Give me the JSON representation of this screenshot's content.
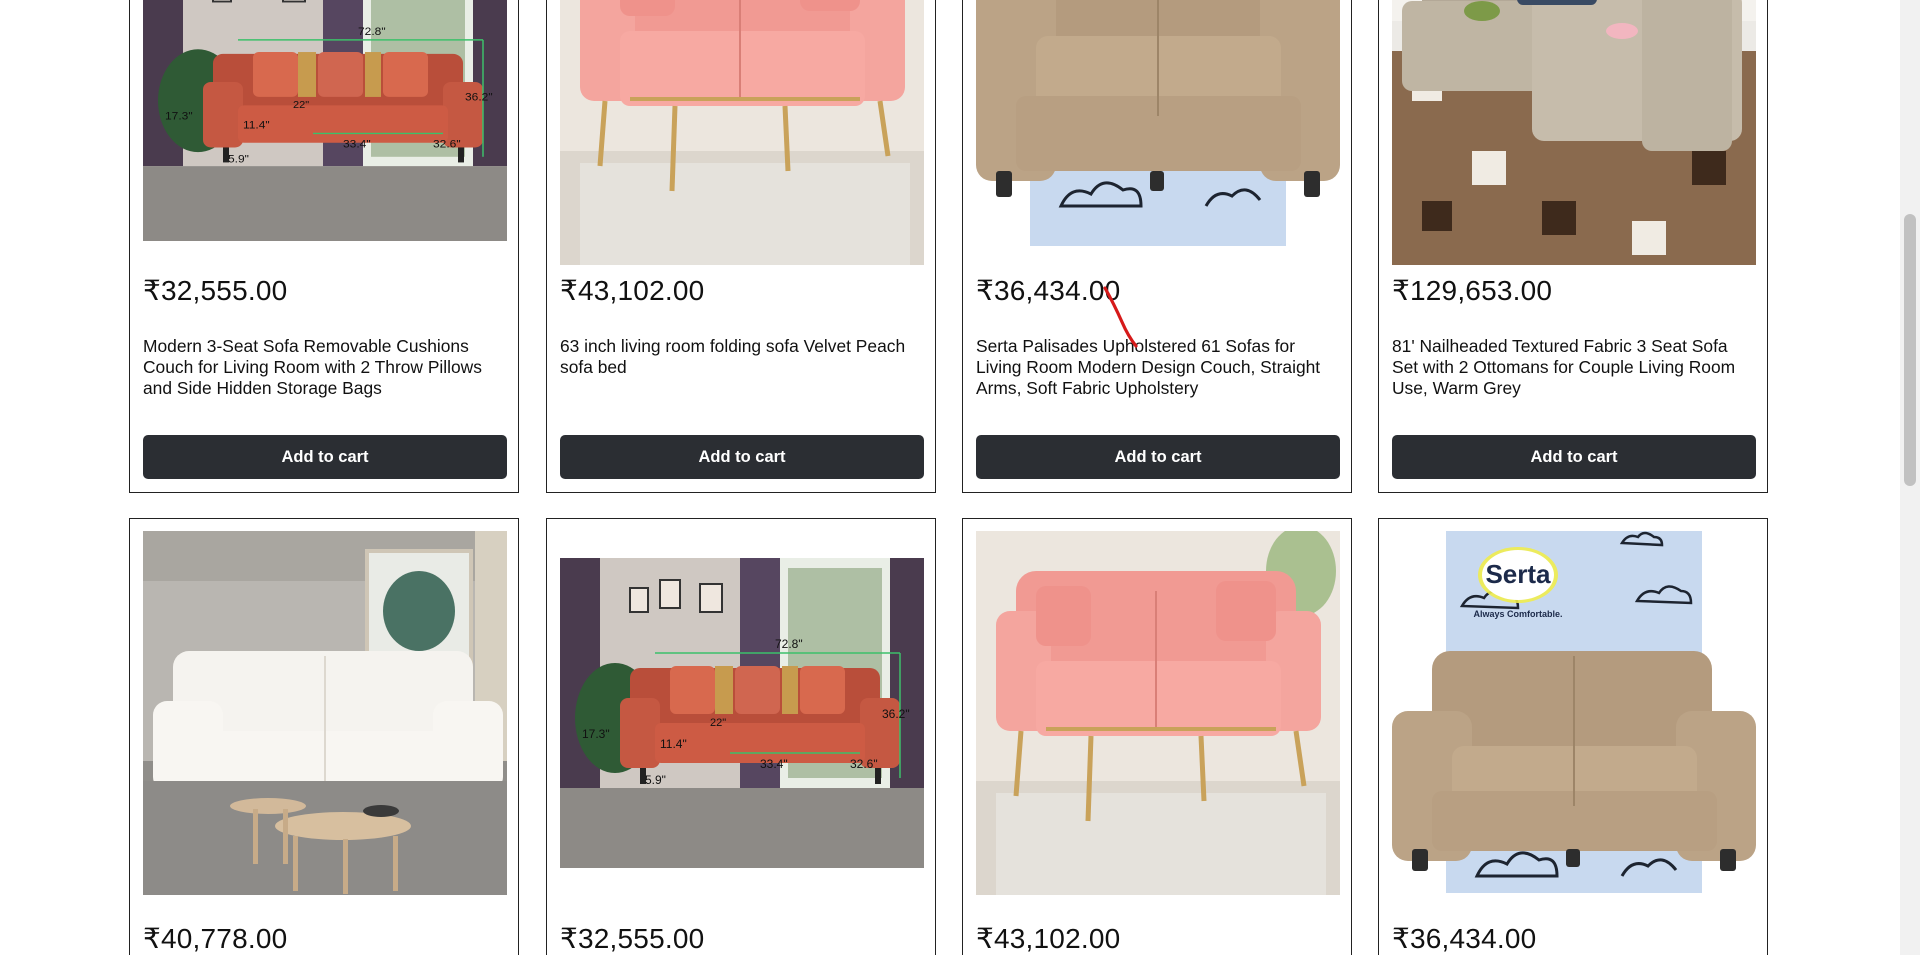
{
  "products_row1": [
    {
      "price": "₹32,555.00",
      "title": "Modern 3-Seat Sofa Removable Cushions Couch for Living Room with 2 Throw Pillows and Side Hidden Storage Bags",
      "button": "Add to cart",
      "image": "coral-sofa-with-dimensions"
    },
    {
      "price": "₹43,102.00",
      "title": "63 inch living room folding sofa Velvet Peach sofa bed",
      "button": "Add to cart",
      "image": "pink-velvet-sofa"
    },
    {
      "price": "₹36,434.00",
      "title": "Serta Palisades Upholstered 61 Sofas for Living Room Modern Design Couch, Straight Arms, Soft Fabric Upholstery",
      "button": "Add to cart",
      "image": "tan-loveseat"
    },
    {
      "price": "₹129,653.00",
      "title": "81' Nailheaded Textured Fabric 3 Seat Sofa Set with 2 Ottomans for Couple Living Room Use, Warm Grey",
      "button": "Add to cart",
      "image": "grey-sectional-sofa"
    }
  ],
  "products_row2": [
    {
      "price": "₹40,778.00",
      "image": "white-sofa"
    },
    {
      "price": "₹32,555.00",
      "image": "coral-sofa-with-dimensions"
    },
    {
      "price": "₹43,102.00",
      "image": "pink-velvet-sofa"
    },
    {
      "price": "₹36,434.00",
      "image": "tan-loveseat-serta"
    }
  ],
  "image_labels": {
    "dims": {
      "width": "72.8\"",
      "height": "36.2\"",
      "arm": "17.3\"",
      "seat_depth": "22\"",
      "seat_height": "11.4\"",
      "seat_width": "33.4\"",
      "depth": "32.6\"",
      "leg": "5.9\""
    },
    "brand": "Serta",
    "tagline": "Always Comfortable."
  },
  "colors": {
    "button_bg": "#2b2e33",
    "button_text": "#ffffff",
    "annotation": "#d61a1a"
  }
}
